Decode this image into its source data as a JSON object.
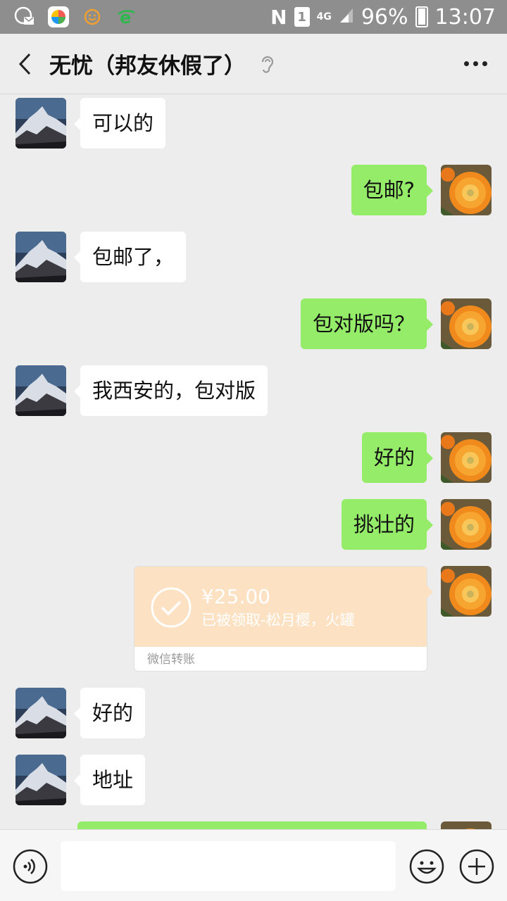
{
  "status_bar": {
    "battery": "96%",
    "time": "13:07",
    "network": "4G",
    "sim": "1",
    "nfc": "N",
    "icons": [
      "mail-globe-icon",
      "app-store-icon",
      "face-app-icon",
      "browser-e-icon"
    ]
  },
  "header": {
    "title": "无忧（邦友休假了）",
    "icons": [
      "back-icon",
      "ear-icon",
      "more-icon"
    ]
  },
  "messages": [
    {
      "side": "left",
      "text": "可以的"
    },
    {
      "side": "right",
      "text": "包邮?"
    },
    {
      "side": "left",
      "text": "包邮了，"
    },
    {
      "side": "right",
      "text": "包对版吗？"
    },
    {
      "side": "left",
      "text": "我西安的，包对版"
    },
    {
      "side": "right",
      "text": "好的"
    },
    {
      "side": "right",
      "text": "挑壮的"
    },
    {
      "side": "left",
      "text": "好的"
    },
    {
      "side": "left",
      "text": "地址"
    }
  ],
  "transfer": {
    "amount": "¥25.00",
    "note": "已被领取-松月樱，火罐",
    "label": "微信转账"
  },
  "input_bar": {
    "placeholder": "",
    "icons": [
      "voice-icon",
      "emoji-icon",
      "plus-icon"
    ]
  },
  "colors": {
    "self_bubble": "#95ec69",
    "other_bubble": "#ffffff",
    "background": "#ededed",
    "transfer_card": "#fde1c3"
  }
}
